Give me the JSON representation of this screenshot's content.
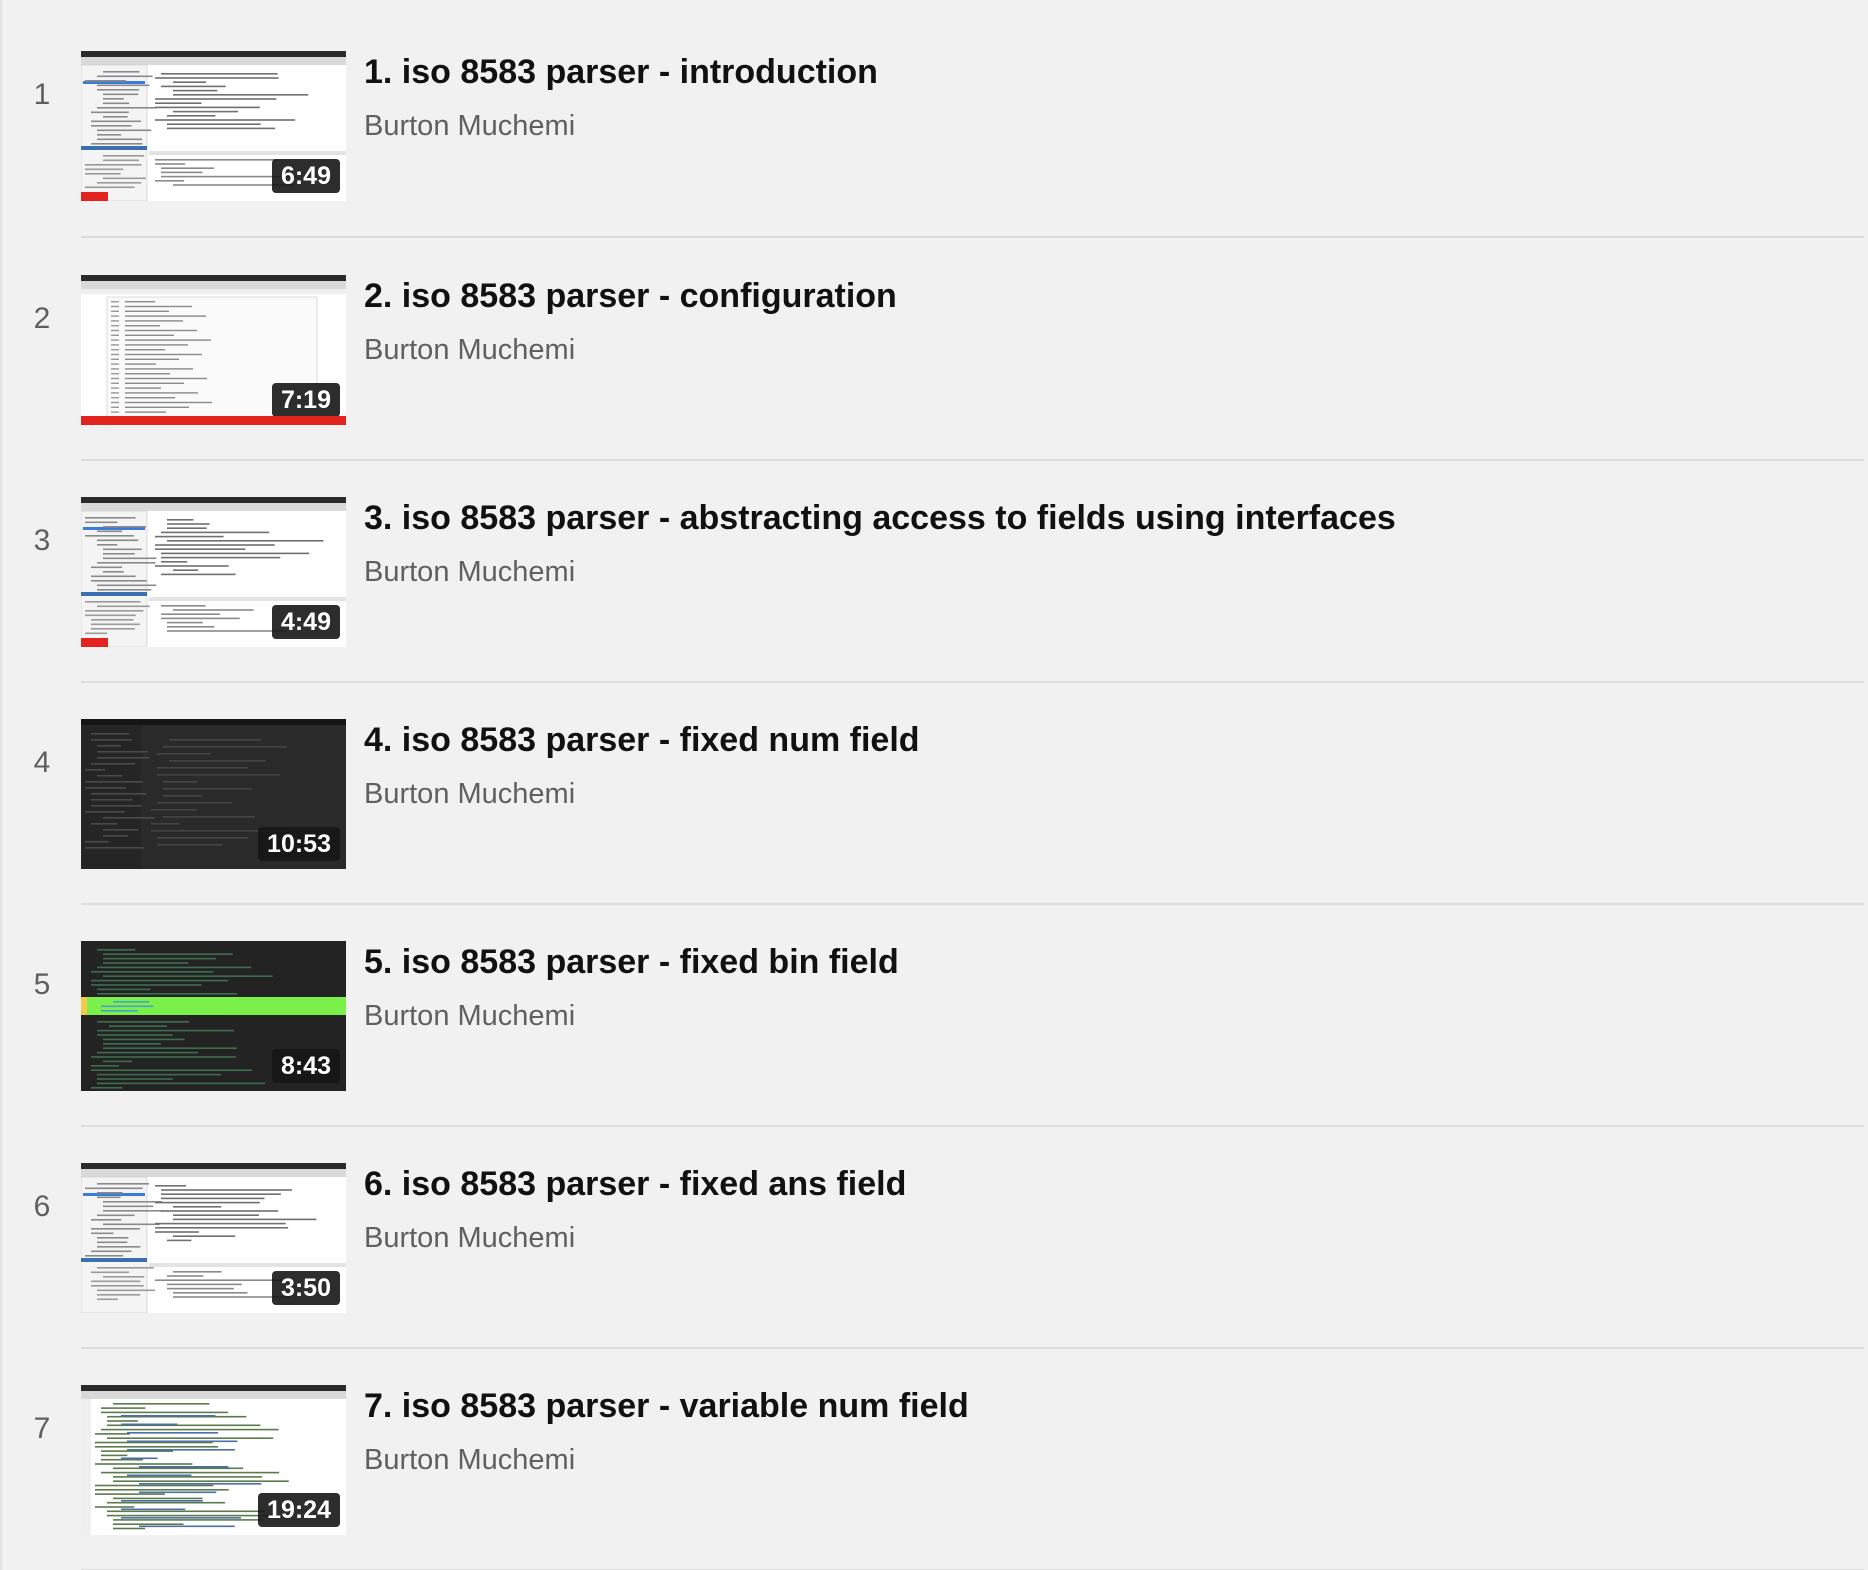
{
  "playlist": {
    "items": [
      {
        "index": "1",
        "title": "1. iso 8583 parser - introduction",
        "channel": "Burton Muchemi",
        "duration": "6:49",
        "watched": 0.1,
        "thumb_theme": "light-ide"
      },
      {
        "index": "2",
        "title": "2. iso 8583 parser - configuration",
        "channel": "Burton Muchemi",
        "duration": "7:19",
        "watched": 1.0,
        "thumb_theme": "light-table"
      },
      {
        "index": "3",
        "title": "3. iso 8583 parser - abstracting access to fields using interfaces",
        "channel": "Burton Muchemi",
        "duration": "4:49",
        "watched": 0.1,
        "thumb_theme": "light-ide"
      },
      {
        "index": "4",
        "title": "4. iso 8583 parser - fixed num field",
        "channel": "Burton Muchemi",
        "duration": "10:53",
        "watched": 0,
        "thumb_theme": "dark-ide"
      },
      {
        "index": "5",
        "title": "5. iso 8583 parser - fixed bin field",
        "channel": "Burton Muchemi",
        "duration": "8:43",
        "watched": 0,
        "thumb_theme": "dark-highlight"
      },
      {
        "index": "6",
        "title": "6. iso 8583 parser - fixed ans field",
        "channel": "Burton Muchemi",
        "duration": "3:50",
        "watched": 0,
        "thumb_theme": "light-ide"
      },
      {
        "index": "7",
        "title": "7. iso 8583 parser - variable num field",
        "channel": "Burton Muchemi",
        "duration": "19:24",
        "watched": 0,
        "thumb_theme": "light-code"
      }
    ]
  },
  "colors": {
    "background": "#f1f1f1",
    "progress": "#e3231d",
    "highlight": "#7cf04a"
  }
}
